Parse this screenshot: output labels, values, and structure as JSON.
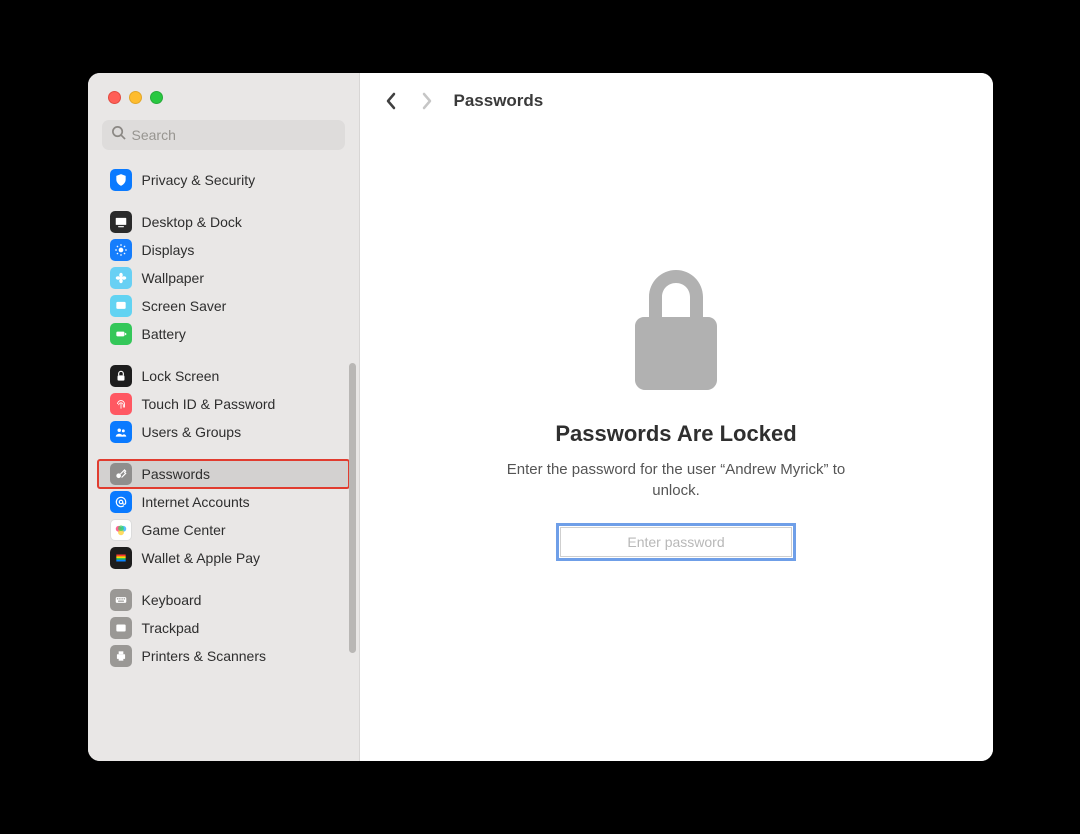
{
  "window": {
    "search_placeholder": "Search"
  },
  "topbar": {
    "title": "Passwords"
  },
  "sidebar": {
    "groups": [
      {
        "items": [
          {
            "label": "Privacy & Security"
          }
        ]
      },
      {
        "items": [
          {
            "label": "Desktop & Dock"
          },
          {
            "label": "Displays"
          },
          {
            "label": "Wallpaper"
          },
          {
            "label": "Screen Saver"
          },
          {
            "label": "Battery"
          }
        ]
      },
      {
        "items": [
          {
            "label": "Lock Screen"
          },
          {
            "label": "Touch ID & Password"
          },
          {
            "label": "Users & Groups"
          }
        ]
      },
      {
        "items": [
          {
            "label": "Passwords"
          },
          {
            "label": "Internet Accounts"
          },
          {
            "label": "Game Center"
          },
          {
            "label": "Wallet & Apple Pay"
          }
        ]
      },
      {
        "items": [
          {
            "label": "Keyboard"
          },
          {
            "label": "Trackpad"
          },
          {
            "label": "Printers & Scanners"
          }
        ]
      }
    ]
  },
  "main": {
    "locked_title": "Passwords Are Locked",
    "locked_message": "Enter the password for the user “Andrew Myrick” to unlock.",
    "password_placeholder": "Enter password"
  }
}
